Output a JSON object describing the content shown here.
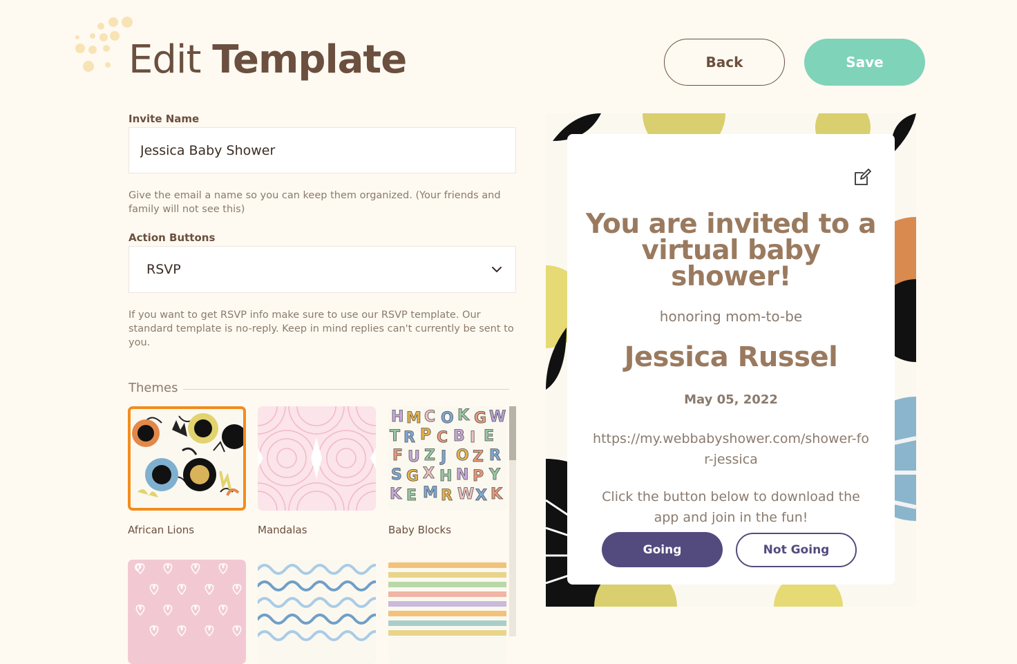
{
  "header": {
    "title_light": "Edit",
    "title_bold": "Template",
    "back_label": "Back",
    "save_label": "Save"
  },
  "form": {
    "invite_name_label": "Invite Name",
    "invite_name_value": "Jessica Baby Shower",
    "invite_name_help": "Give the email a name so you can keep them organized. (Your friends and family will not see this)",
    "action_buttons_label": "Action Buttons",
    "action_buttons_value": "RSVP",
    "action_buttons_help": "If you want to get RSVP info make sure to use our RSVP template. Our standard template is no-reply. Keep in mind replies can't currently be sent to you."
  },
  "themes": {
    "label": "Themes",
    "selected": "African Lions",
    "items": [
      {
        "name": "African Lions"
      },
      {
        "name": "Mandalas"
      },
      {
        "name": "Baby Blocks"
      },
      {
        "name": ""
      },
      {
        "name": ""
      },
      {
        "name": ""
      }
    ]
  },
  "preview": {
    "heading": "You are invited to a virtual baby shower!",
    "honoring": "honoring mom-to-be",
    "honoree": "Jessica Russel",
    "date": "May 05, 2022",
    "url": "https://my.webbabyshower.com/shower-for-jessica",
    "cta": "Click the button below to download the app and join in the fun!",
    "going_label": "Going",
    "not_going_label": "Not Going"
  },
  "colors": {
    "background": "#fefaf1",
    "brown": "#6b4f3f",
    "save_green": "#7fd3b8",
    "selected_orange": "#f28c1d",
    "purple": "#534b7e"
  },
  "icons": [
    "dots-decoration-icon",
    "chevron-down-icon",
    "edit-icon"
  ]
}
